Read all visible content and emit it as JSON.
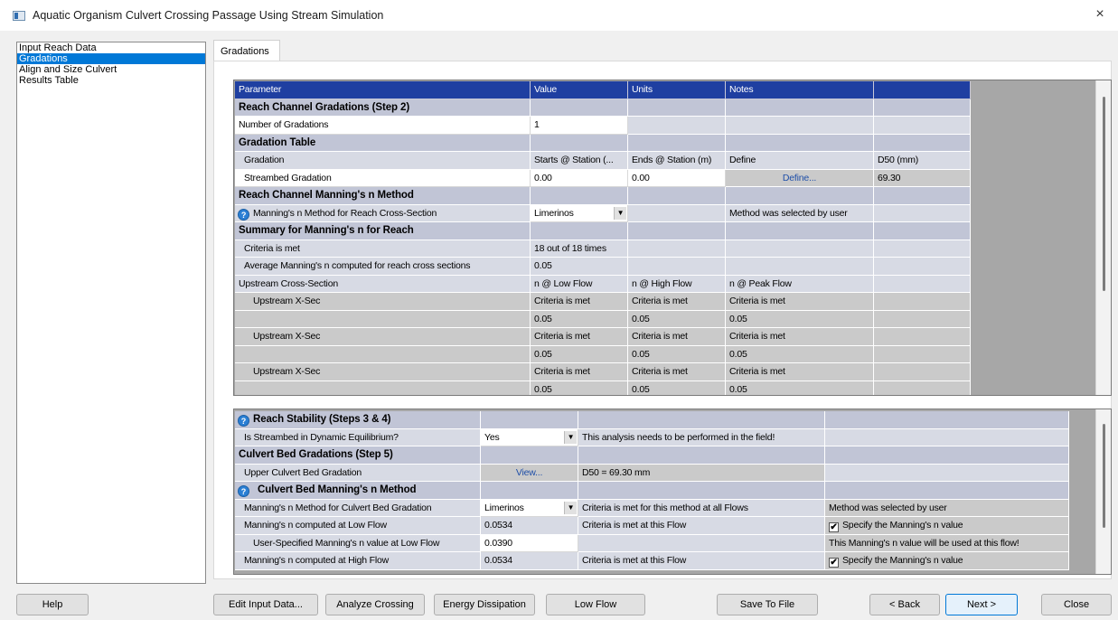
{
  "window": {
    "title": "Aquatic Organism Culvert Crossing Passage Using Stream Simulation",
    "close": "×"
  },
  "nav": {
    "items": [
      "Input Reach Data",
      "Gradations",
      "Align and Size Culvert",
      "Results Table"
    ]
  },
  "tab": {
    "label": "Gradations"
  },
  "grid1": {
    "headers": [
      "Parameter",
      "Value",
      "Units",
      "Notes",
      ""
    ],
    "sec_reach_channel": "Reach Channel Gradations (Step 2)",
    "num_gradations_label": "Number of Gradations",
    "num_gradations_value": "1",
    "sec_gradation_table": "Gradation Table",
    "gt_headers": [
      "Gradation",
      "Starts @ Station (...",
      "Ends @ Station (m)",
      "Define",
      "D50 (mm)"
    ],
    "streambed": {
      "label": "Streambed Gradation",
      "start": "0.00",
      "end": "0.00",
      "define": "Define...",
      "d50": "69.30"
    },
    "sec_mannings_method": "Reach Channel Manning's n Method",
    "method_label": "Manning's n Method for Reach Cross-Section",
    "method_value": "Limerinos",
    "method_note": "Method was selected by user",
    "sec_summary": "Summary for Manning's n for Reach",
    "criteria_label": "Criteria is met",
    "criteria_value": "18 out of 18 times",
    "avg_label": "Average Manning's n computed for reach cross sections",
    "avg_value": "0.05",
    "upstream_header": [
      "Upstream Cross-Section",
      "n @ Low Flow",
      "n @ High Flow",
      "n @ Peak Flow"
    ],
    "xsecs": [
      {
        "label": "Upstream X-Sec",
        "low": "Criteria is met",
        "high": "Criteria is met",
        "peak": "Criteria is met",
        "n_low": "0.05",
        "n_high": "0.05",
        "n_peak": "0.05"
      },
      {
        "label": "Upstream X-Sec",
        "low": "Criteria is met",
        "high": "Criteria is met",
        "peak": "Criteria is met",
        "n_low": "0.05",
        "n_high": "0.05",
        "n_peak": "0.05"
      },
      {
        "label": "Upstream X-Sec",
        "low": "Criteria is met",
        "high": "Criteria is met",
        "peak": "Criteria is met",
        "n_low": "0.05",
        "n_high": "0.05",
        "n_peak": "0.05"
      }
    ]
  },
  "grid2": {
    "sec_stability": "Reach Stability (Steps 3 & 4)",
    "equilibrium_label": "Is Streambed in Dynamic Equilibrium?",
    "equilibrium_value": "Yes",
    "equilibrium_note": "This analysis needs to be performed in the field!",
    "sec_culvert_grad": "Culvert Bed Gradations (Step 5)",
    "upper_label": "Upper Culvert Bed Gradation",
    "upper_button": "View...",
    "upper_d50": "D50 = 69.30 mm",
    "sec_culvert_mannings": "Culvert Bed Manning's n Method",
    "cb_method_label": "Manning's n Method for Culvert Bed Gradation",
    "cb_method_value": "Limerinos",
    "cb_method_note": "Criteria is met for this method at all Flows",
    "cb_method_note2": "Method was selected by user",
    "low_label": "Manning's n computed at Low Flow",
    "low_value": "0.0534",
    "low_note": "Criteria is met at this Flow",
    "low_specify": "Specify the Manning's n value",
    "user_low_label": "User-Specified Manning's n value at Low Flow",
    "user_low_value": "0.0390",
    "user_low_note": "This Manning's n value will be used at this flow!",
    "high_label": "Manning's n computed at High Flow",
    "high_value": "0.0534",
    "high_note": "Criteria is met at this Flow",
    "high_specify": "Specify the Manning's n value",
    "check_mark": "✔",
    "dropdown_arrow": "▼",
    "info_glyph": "?"
  },
  "buttons": {
    "help": "Help",
    "edit_input": "Edit Input Data...",
    "analyze": "Analyze Crossing",
    "energy": "Energy Dissipation",
    "low_flow": "Low Flow",
    "save": "Save To File",
    "back": "< Back",
    "next": "Next >",
    "close": "Close"
  },
  "colors": {
    "selection": "#0078d7",
    "grid_header": "#1f3fa1",
    "section": "#c1c5d6"
  }
}
